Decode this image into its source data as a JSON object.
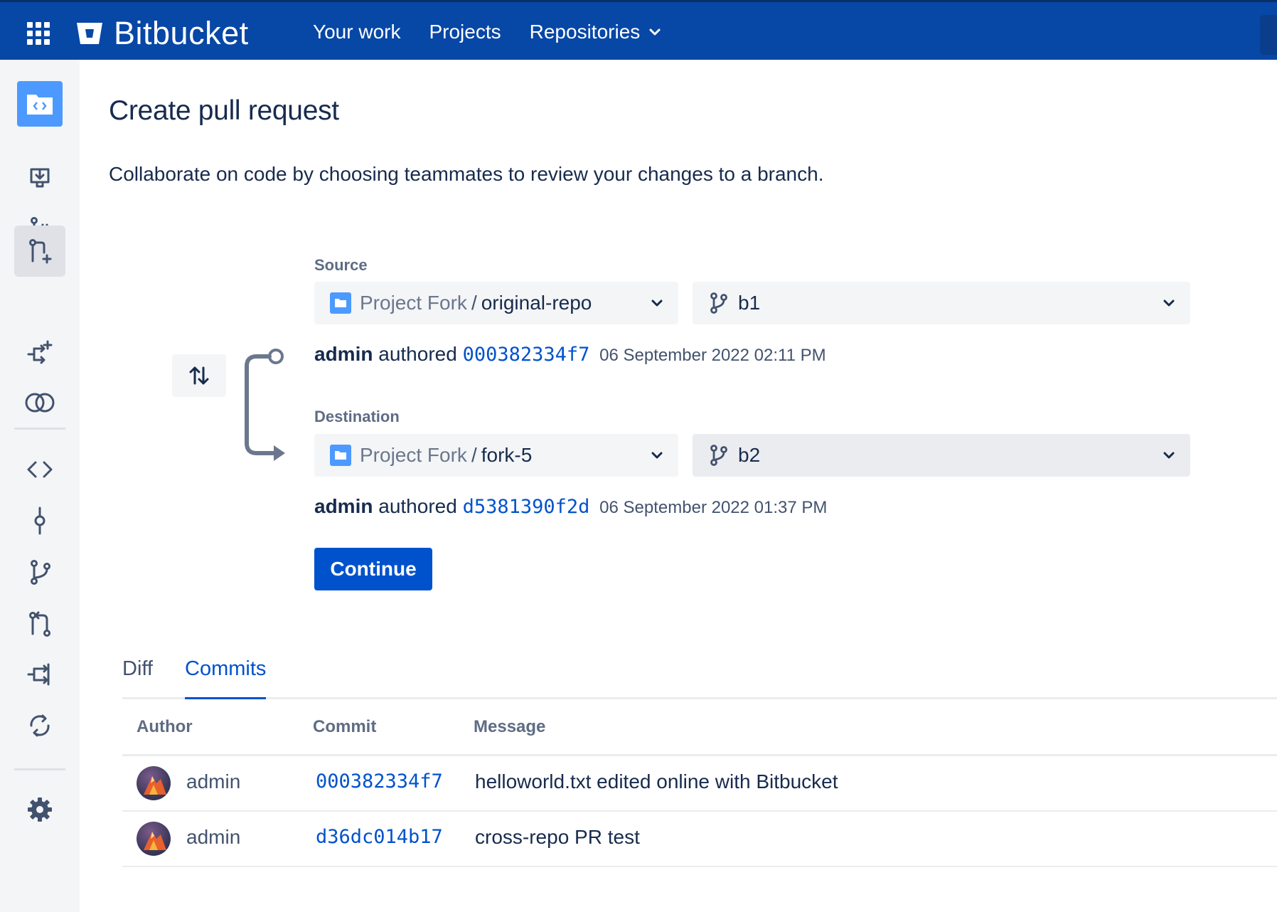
{
  "header": {
    "brand": "Bitbucket",
    "nav": [
      {
        "label": "Your work"
      },
      {
        "label": "Projects"
      },
      {
        "label": "Repositories"
      }
    ]
  },
  "page": {
    "title": "Create pull request",
    "description": "Collaborate on code by choosing teammates to review your changes to a branch."
  },
  "source": {
    "label": "Source",
    "project": "Project Fork",
    "separator": "/",
    "repo": "original-repo",
    "branch": "b1",
    "author": "admin",
    "authored_word": "authored",
    "commit": "000382334f7",
    "date": "06 September 2022 02:11 PM"
  },
  "destination": {
    "label": "Destination",
    "project": "Project Fork",
    "separator": "/",
    "repo": "fork-5",
    "branch": "b2",
    "author": "admin",
    "authored_word": "authored",
    "commit": "d5381390f2d",
    "date": "06 September 2022 01:37 PM"
  },
  "actions": {
    "continue_label": "Continue"
  },
  "tabs": [
    {
      "label": "Diff",
      "active": false
    },
    {
      "label": "Commits",
      "active": true
    }
  ],
  "commits_table": {
    "columns": [
      "Author",
      "Commit",
      "Message"
    ],
    "rows": [
      {
        "author": "admin",
        "commit": "000382334f7",
        "message": "helloworld.txt edited online with Bitbucket"
      },
      {
        "author": "admin",
        "commit": "d36dc014b17",
        "message": "cross-repo PR test"
      }
    ]
  },
  "colors": {
    "topbar": "#0747a6",
    "primary": "#0052cc",
    "sidebar": "#f4f5f7",
    "text": "#172b4d"
  },
  "icons": {
    "sidebar": [
      "repository-icon",
      "clone-icon",
      "create-branch-icon",
      "create-pull-request-icon",
      "create-fork-icon",
      "compare-icon",
      "source-icon",
      "commits-icon",
      "branches-icon",
      "pull-requests-icon",
      "forks-icon",
      "builds-icon",
      "settings-icon"
    ]
  }
}
